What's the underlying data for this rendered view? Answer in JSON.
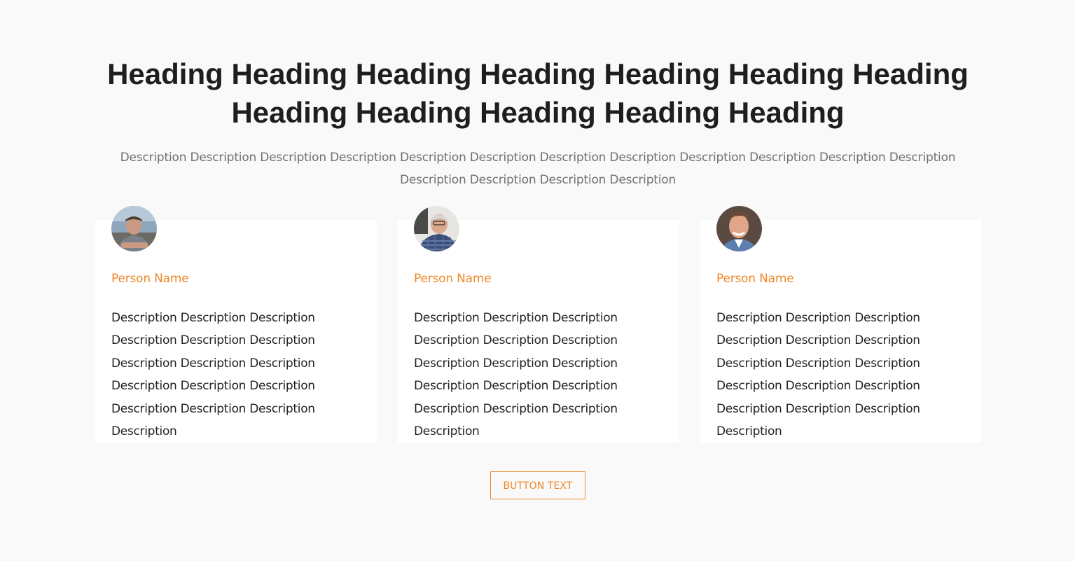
{
  "header": {
    "title": "Heading Heading Heading Heading Heading Heading Heading Heading Heading Heading Heading Heading",
    "description": "Description Description Description Description Description Description Description Description Description Description Description Description Description Description Description Description"
  },
  "cards": [
    {
      "name": "Person Name",
      "description": "Description Description Description Description Description Description Description Description Description Description Description Description Description Description Description Description",
      "avatar_icon": "person-photo-1"
    },
    {
      "name": "Person Name",
      "description": "Description Description Description Description Description Description Description Description Description Description Description Description Description Description Description Description",
      "avatar_icon": "person-photo-2"
    },
    {
      "name": "Person Name",
      "description": "Description Description Description Description Description Description Description Description Description Description Description Description Description Description Description Description",
      "avatar_icon": "person-photo-3"
    }
  ],
  "cta": {
    "label": "BUTTON TEXT"
  },
  "colors": {
    "accent": "#f0882c",
    "background": "#f9f9f9",
    "card": "#ffffff",
    "heading": "#1e1e1e",
    "muted": "#707070"
  }
}
